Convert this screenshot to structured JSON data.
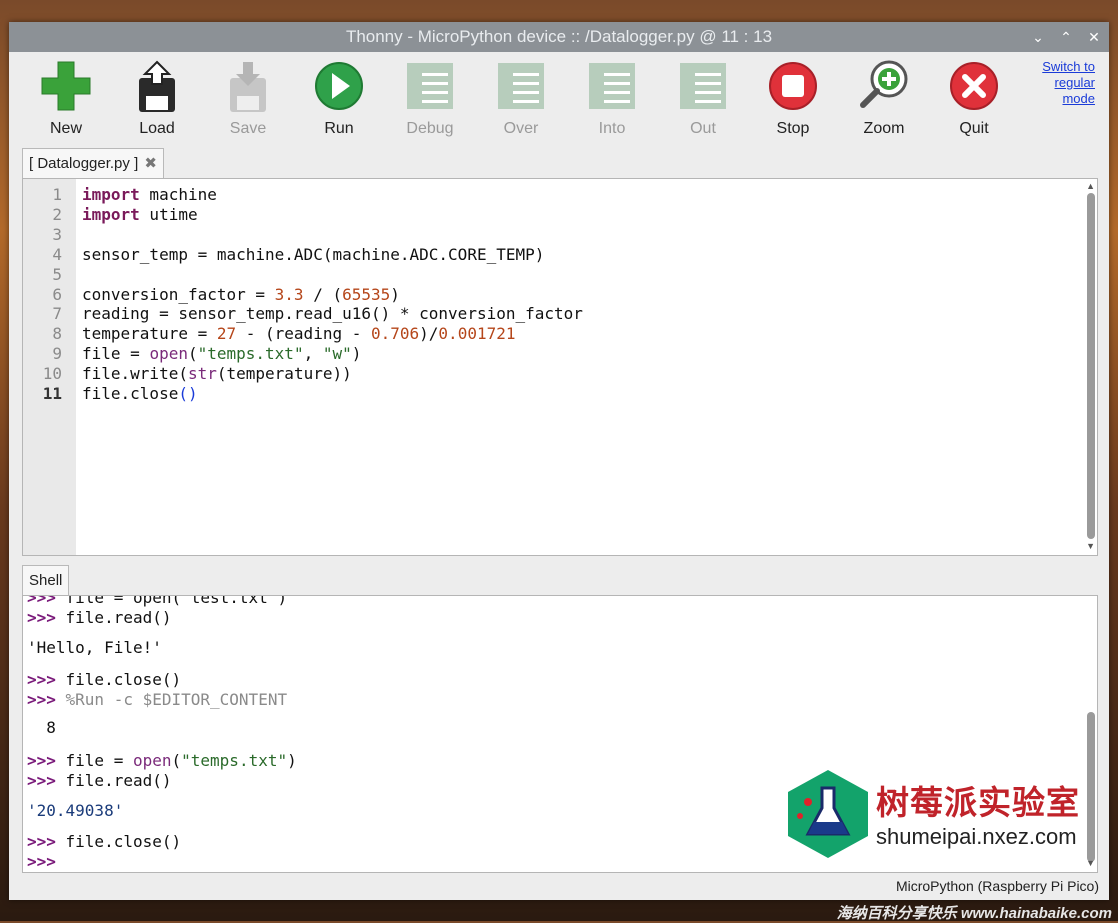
{
  "window": {
    "title": "Thonny  -  MicroPython device :: /Datalogger.py  @  11 : 13",
    "controls": [
      "⌄",
      "⌃",
      "✕"
    ]
  },
  "toolbar": {
    "new": "New",
    "load": "Load",
    "save": "Save",
    "run": "Run",
    "debug": "Debug",
    "over": "Over",
    "into": "Into",
    "out": "Out",
    "stop": "Stop",
    "zoom": "Zoom",
    "quit": "Quit",
    "switch_mode": [
      "Switch to",
      "regular",
      "mode"
    ]
  },
  "editor": {
    "tab_label": "[ Datalogger.py ]",
    "tab_close": "✖",
    "line_numbers": [
      "1",
      "2",
      "3",
      "4",
      "5",
      "6",
      "7",
      "8",
      "9",
      "10",
      "11"
    ],
    "lines": [
      [
        {
          "t": "import",
          "c": "kw"
        },
        {
          "t": " machine",
          "c": ""
        }
      ],
      [
        {
          "t": "import",
          "c": "kw"
        },
        {
          "t": " utime",
          "c": ""
        }
      ],
      [],
      [
        {
          "t": "sensor_temp = machine.ADC(machine.ADC.CORE_TEMP)",
          "c": ""
        }
      ],
      [],
      [
        {
          "t": "conversion_factor = ",
          "c": ""
        },
        {
          "t": "3.3",
          "c": "num"
        },
        {
          "t": " / (",
          "c": ""
        },
        {
          "t": "65535",
          "c": "num"
        },
        {
          "t": ")",
          "c": ""
        }
      ],
      [
        {
          "t": "reading = sensor_temp.read_u16() * conversion_factor",
          "c": ""
        }
      ],
      [
        {
          "t": "temperature = ",
          "c": ""
        },
        {
          "t": "27",
          "c": "num"
        },
        {
          "t": " - (reading - ",
          "c": ""
        },
        {
          "t": "0.706",
          "c": "num"
        },
        {
          "t": ")/",
          "c": ""
        },
        {
          "t": "0.001721",
          "c": "num"
        }
      ],
      [
        {
          "t": "file = ",
          "c": ""
        },
        {
          "t": "open",
          "c": "bi"
        },
        {
          "t": "(",
          "c": ""
        },
        {
          "t": "\"temps.txt\"",
          "c": "str"
        },
        {
          "t": ", ",
          "c": ""
        },
        {
          "t": "\"w\"",
          "c": "str"
        },
        {
          "t": ")",
          "c": ""
        }
      ],
      [
        {
          "t": "file.write(",
          "c": ""
        },
        {
          "t": "str",
          "c": "bi"
        },
        {
          "t": "(temperature))",
          "c": ""
        }
      ],
      [
        {
          "t": "file.close",
          "c": ""
        },
        {
          "t": "()",
          "c": "paren"
        }
      ]
    ]
  },
  "shell": {
    "tab_label": "Shell",
    "lines": [
      [
        {
          "t": ">>> ",
          "c": "prompt"
        },
        {
          "t": "file = open(\"test.txt\")",
          "c": ""
        }
      ],
      [
        {
          "t": ">>> ",
          "c": "prompt"
        },
        {
          "t": "file.read()",
          "c": ""
        }
      ],
      [
        {
          "t": "'Hello, File!'",
          "c": ""
        }
      ],
      [
        {
          "t": ">>> ",
          "c": "prompt"
        },
        {
          "t": "file.close()",
          "c": ""
        }
      ],
      [
        {
          "t": ">>> ",
          "c": "prompt"
        },
        {
          "t": "%Run -c $EDITOR_CONTENT",
          "c": "grey"
        }
      ],
      [
        {
          "t": "  8",
          "c": ""
        }
      ],
      [
        {
          "t": ">>> ",
          "c": "prompt"
        },
        {
          "t": "file = ",
          "c": ""
        },
        {
          "t": "open",
          "c": "bi"
        },
        {
          "t": "(",
          "c": ""
        },
        {
          "t": "\"temps.txt\"",
          "c": "str"
        },
        {
          "t": ")",
          "c": ""
        }
      ],
      [
        {
          "t": ">>> ",
          "c": "prompt"
        },
        {
          "t": "file.read()",
          "c": ""
        }
      ],
      [
        {
          "t": "'20.49038'",
          "c": "outstr"
        }
      ],
      [
        {
          "t": ">>> ",
          "c": "prompt"
        },
        {
          "t": "file.close()",
          "c": ""
        }
      ],
      [
        {
          "t": ">>>",
          "c": "prompt"
        }
      ]
    ],
    "status": "MicroPython (Raspberry Pi Pico)"
  },
  "watermark": {
    "chinese": "树莓派实验室",
    "url": "shumeipai.nxez.com",
    "footer": "海纳百科分享快乐 www.hainabaike.com"
  }
}
